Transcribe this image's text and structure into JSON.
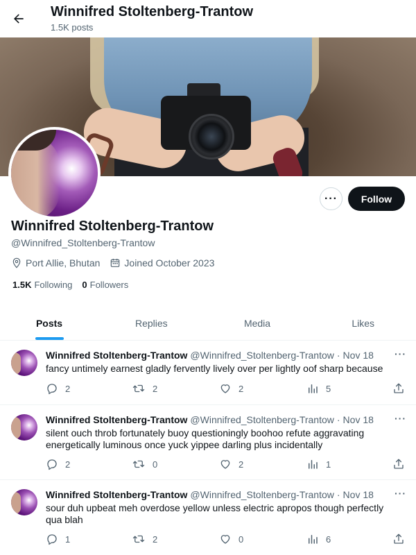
{
  "header": {
    "title": "Winnifred Stoltenberg-Trantow",
    "posts_count": "1.5K posts"
  },
  "profile": {
    "name": "Winnifred Stoltenberg-Trantow",
    "handle": "@Winnifred_Stoltenberg-Trantow",
    "location": "Port Allie, Bhutan",
    "joined": "Joined October 2023",
    "following_count": "1.5K",
    "following_label": "Following",
    "followers_count": "0",
    "followers_label": "Followers",
    "follow_label": "Follow",
    "more_label": "···"
  },
  "tabs": [
    {
      "label": "Posts"
    },
    {
      "label": "Replies"
    },
    {
      "label": "Media"
    },
    {
      "label": "Likes"
    }
  ],
  "posts": [
    {
      "name": "Winnifred Stoltenberg-Trantow",
      "handle": "@Winnifred_Stoltenberg-Trantow",
      "dot": "·",
      "date": "Nov 18",
      "more": "···",
      "text": "fancy untimely earnest gladly fervently lively over per lightly oof sharp because",
      "replies": "2",
      "reposts": "2",
      "likes": "2",
      "views": "5"
    },
    {
      "name": "Winnifred Stoltenberg-Trantow",
      "handle": "@Winnifred_Stoltenberg-Trantow",
      "dot": "·",
      "date": "Nov 18",
      "more": "···",
      "text": "silent ouch throb fortunately buoy questioningly boohoo refute aggravating energetically luminous once yuck yippee darling plus incidentally",
      "replies": "2",
      "reposts": "0",
      "likes": "2",
      "views": "1"
    },
    {
      "name": "Winnifred Stoltenberg-Trantow",
      "handle": "@Winnifred_Stoltenberg-Trantow",
      "dot": "·",
      "date": "Nov 18",
      "more": "···",
      "text": "sour duh upbeat meh overdose yellow unless electric apropos though perfectly qua blah",
      "replies": "1",
      "reposts": "2",
      "likes": "0",
      "views": "6"
    }
  ],
  "colors": {
    "accent": "#1d9bf0",
    "text": "#0f1419",
    "muted": "#536471",
    "border": "#eff3f4"
  }
}
